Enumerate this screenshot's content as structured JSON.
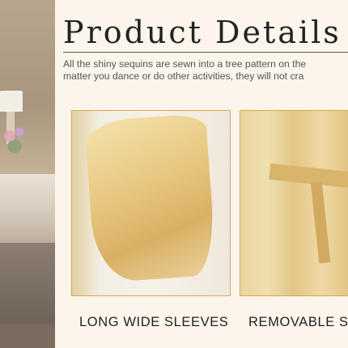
{
  "title": "Product Details",
  "description": {
    "line1": "All the shiny sequins are sewn into a tree pattern on the",
    "line2": "matter you dance or do other activities, they will not cra"
  },
  "features": [
    {
      "caption": "LONG WIDE SLEEVES"
    },
    {
      "caption": "REMOVABLE SA"
    }
  ],
  "colors": {
    "accent_border": "#d8a94f",
    "background": "#fbf5ec",
    "satin_gold": "#e6c47c"
  }
}
